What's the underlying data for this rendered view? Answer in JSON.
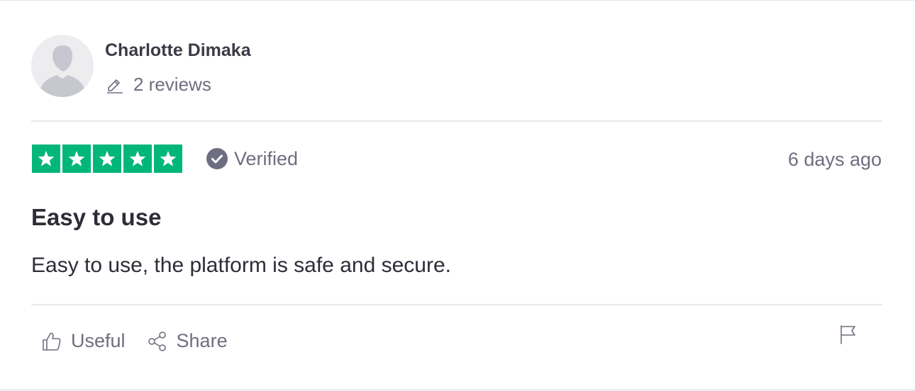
{
  "reviewer": {
    "name": "Charlotte Dimaka",
    "review_count": "2 reviews",
    "avatar_icon": "person-silhouette-icon"
  },
  "rating": {
    "stars": 5,
    "max_stars": 5,
    "star_color": "#00b67a",
    "verified_label": "Verified",
    "date": "6 days ago"
  },
  "review": {
    "title": "Easy to use",
    "text": "Easy to use, the platform is safe and secure."
  },
  "actions": {
    "useful_label": "Useful",
    "share_label": "Share",
    "useful_icon": "thumbs-up-icon",
    "share_icon": "share-icon",
    "flag_icon": "flag-icon"
  },
  "colors": {
    "text_primary": "#2d2d38",
    "text_secondary": "#6e6e80",
    "divider": "#e8e8ec",
    "avatar_bg": "#ededf0"
  }
}
